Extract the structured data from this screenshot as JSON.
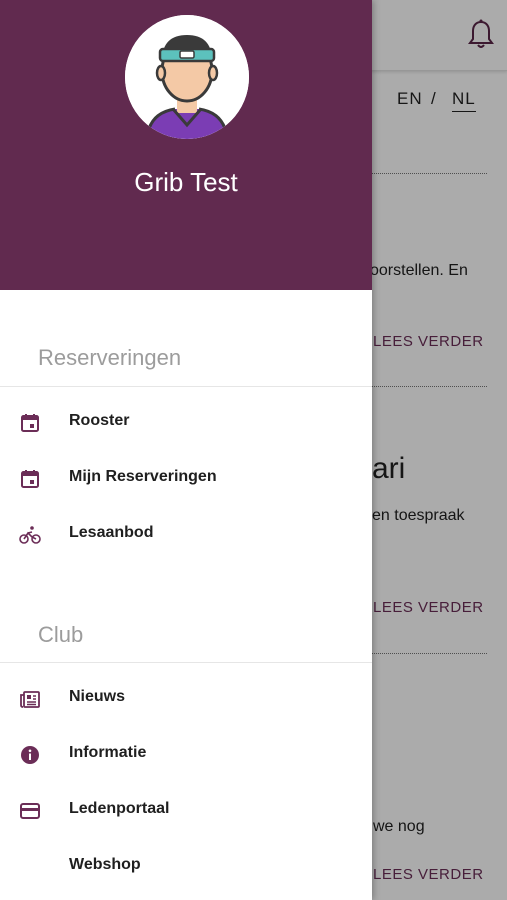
{
  "background": {
    "lang_en": "EN",
    "lang_sep": "/",
    "lang_nl": "NL",
    "snippet1": "oorstellen. En",
    "read_more": "LEES VERDER",
    "heading_fragment": "ari",
    "snippet2": "en toespraak",
    "snippet3": "we nog"
  },
  "drawer": {
    "username": "Grib Test",
    "sections": [
      {
        "title": "Reserveringen",
        "items": [
          {
            "label": "Rooster",
            "icon": "calendar-icon"
          },
          {
            "label": "Mijn Reserveringen",
            "icon": "calendar-icon"
          },
          {
            "label": "Lesaanbod",
            "icon": "bicycle-icon"
          }
        ]
      },
      {
        "title": "Club",
        "items": [
          {
            "label": "Nieuws",
            "icon": "newspaper-icon"
          },
          {
            "label": "Informatie",
            "icon": "info-icon"
          },
          {
            "label": "Ledenportaal",
            "icon": "credit-card-icon"
          },
          {
            "label": "Webshop",
            "icon": ""
          }
        ]
      }
    ]
  },
  "colors": {
    "brand": "#612a4f",
    "icon": "#6b2d57"
  }
}
